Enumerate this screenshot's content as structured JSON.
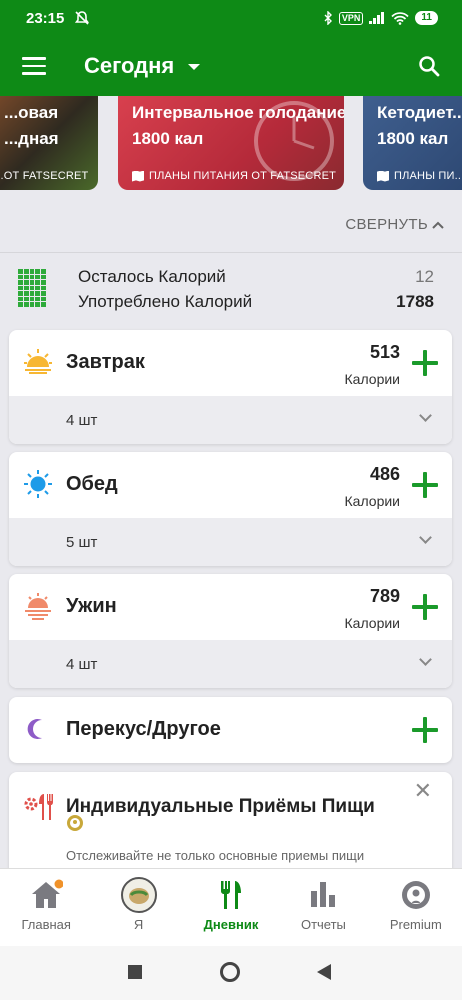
{
  "status": {
    "time": "23:15",
    "vpn": "VPN",
    "battery": "11"
  },
  "appbar": {
    "title": "Сегодня"
  },
  "plans": [
    {
      "title_line1": "...овая",
      "title_line2": "...дная",
      "footer": "...ОТ FATSECRET"
    },
    {
      "title_line1": "Интервальное голодание",
      "title_line2": "1800 кал",
      "footer": "ПЛАНЫ ПИТАНИЯ ОТ FATSECRET"
    },
    {
      "title_line1": "Кетодиет...",
      "title_line2": "1800 кал",
      "footer": "ПЛАНЫ ПИ..."
    }
  ],
  "collapse_label": "СВЕРНУТЬ",
  "summary": {
    "remaining_label": "Осталось Калорий",
    "remaining_value": "12",
    "consumed_label": "Употреблено Калорий",
    "consumed_value": "1788"
  },
  "meals": [
    {
      "name": "Завтрак",
      "kcal": "513",
      "kcal_label": "Калории",
      "count": "4 шт"
    },
    {
      "name": "Обед",
      "kcal": "486",
      "kcal_label": "Калории",
      "count": "5 шт"
    },
    {
      "name": "Ужин",
      "kcal": "789",
      "kcal_label": "Калории",
      "count": "4 шт"
    }
  ],
  "snack": {
    "name": "Перекус/Другое"
  },
  "promo": {
    "title": "Индивидуальные Приёмы Пищи",
    "subtitle": "Отслеживайте не только основные приемы пищи"
  },
  "nav": [
    {
      "label": "Главная"
    },
    {
      "label": "Я"
    },
    {
      "label": "Дневник"
    },
    {
      "label": "Отчеты"
    },
    {
      "label": "Premium"
    }
  ],
  "colors": {
    "brand": "#0e8a16",
    "accent_plus": "#1a9a2a",
    "badge": "#f0922a"
  }
}
